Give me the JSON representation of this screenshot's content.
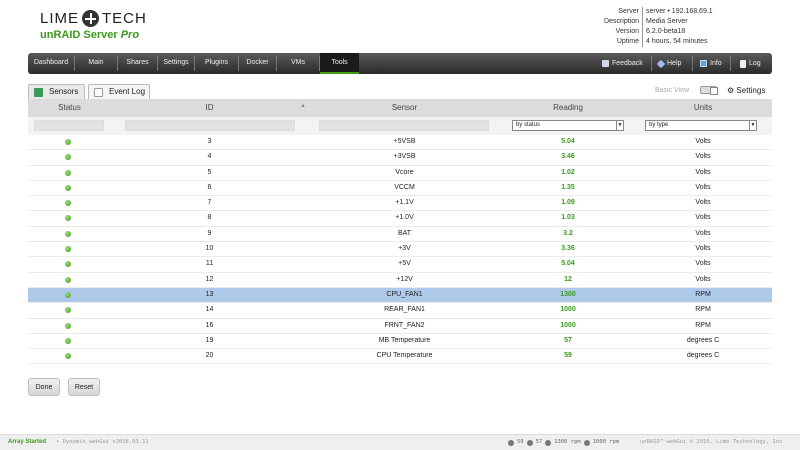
{
  "brand": {
    "logo_text_left": "LIME",
    "logo_text_right": "TECH",
    "product": "unRAID Server ",
    "edition": "Pro"
  },
  "server_info": [
    {
      "key": "Server",
      "value": "server • 192.168.69.1"
    },
    {
      "key": "Description",
      "value": "Media Server"
    },
    {
      "key": "Version",
      "value": "6.2.0-beta18"
    },
    {
      "key": "Uptime",
      "value": "4 hours, 54 minutes"
    }
  ],
  "nav": {
    "items": [
      "Dashboard",
      "Main",
      "Shares",
      "Settings",
      "Plugins",
      "Docker",
      "VMs",
      "Tools"
    ],
    "active": "Tools",
    "right": {
      "feedback": "Feedback",
      "help": "Help",
      "info": "Info",
      "log": "Log"
    }
  },
  "tabs": {
    "sensors": "Sensors",
    "event_log": "Event Log"
  },
  "view": {
    "basic_view": "Basic View",
    "settings": "Settings"
  },
  "table": {
    "headers": {
      "status": "Status",
      "id": "ID",
      "sensor": "Sensor",
      "reading": "Reading",
      "units": "Units"
    },
    "filters": {
      "reading": "by status",
      "units": "by type"
    },
    "rows": [
      {
        "id": "3",
        "sensor": "+5VSB",
        "reading": "5.04",
        "units": "Volts"
      },
      {
        "id": "4",
        "sensor": "+3VSB",
        "reading": "3.46",
        "units": "Volts"
      },
      {
        "id": "5",
        "sensor": "Vcore",
        "reading": "1.02",
        "units": "Volts"
      },
      {
        "id": "6",
        "sensor": "VCCM",
        "reading": "1.35",
        "units": "Volts"
      },
      {
        "id": "7",
        "sensor": "+1.1V",
        "reading": "1.09",
        "units": "Volts"
      },
      {
        "id": "8",
        "sensor": "+1.0V",
        "reading": "1.03",
        "units": "Volts"
      },
      {
        "id": "9",
        "sensor": "BAT",
        "reading": "3.2",
        "units": "Volts"
      },
      {
        "id": "10",
        "sensor": "+3V",
        "reading": "3.36",
        "units": "Volts"
      },
      {
        "id": "11",
        "sensor": "+5V",
        "reading": "5.04",
        "units": "Volts"
      },
      {
        "id": "12",
        "sensor": "+12V",
        "reading": "12",
        "units": "Volts"
      },
      {
        "id": "13",
        "sensor": "CPU_FAN1",
        "reading": "1300",
        "units": "RPM"
      },
      {
        "id": "14",
        "sensor": "REAR_FAN1",
        "reading": "1000",
        "units": "RPM"
      },
      {
        "id": "16",
        "sensor": "FRNT_FAN2",
        "reading": "1000",
        "units": "RPM"
      },
      {
        "id": "19",
        "sensor": "MB Temperature",
        "reading": "57",
        "units": "degrees C"
      },
      {
        "id": "20",
        "sensor": "CPU Temperature",
        "reading": "59",
        "units": "degrees C"
      }
    ],
    "selected_id": "13"
  },
  "buttons": {
    "done": "Done",
    "reset": "Reset"
  },
  "footer": {
    "status": "Array Started",
    "version": "• Dynamix webGui v2016.03.11",
    "sensor_mb": "59",
    "sensor_cpu": "57",
    "sensor_fan1": "1300 rpm",
    "sensor_fan2": "1000 rpm",
    "copyright": "unRAID™ webGui © 2016, Lime Technology, Inc."
  },
  "colors": {
    "accent": "#3b9a1e",
    "selected_row": "#aec9ea",
    "nav_bg": "#2a2a2a"
  }
}
